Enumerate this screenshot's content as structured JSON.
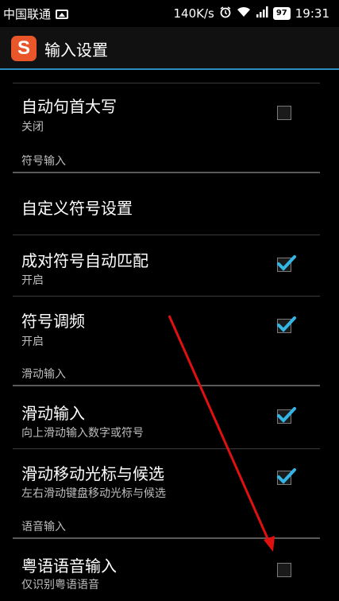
{
  "status_bar": {
    "carrier": "中国联通",
    "speed": "140K/s",
    "battery": "97",
    "time": "19:31"
  },
  "action_bar": {
    "app_icon_letter": "S",
    "title": "输入设置"
  },
  "settings": {
    "auto_cap": {
      "title": "自动句首大写",
      "summary": "关闭",
      "checked": false
    },
    "symbol_section": "符号输入",
    "custom_symbol": {
      "title": "自定义符号设置"
    },
    "pair_match": {
      "title": "成对符号自动匹配",
      "summary": "开启",
      "checked": true
    },
    "symbol_freq": {
      "title": "符号调频",
      "summary": "开启",
      "checked": true
    },
    "swipe_section": "滑动输入",
    "swipe_input": {
      "title": "滑动输入",
      "summary": "向上滑动输入数字或符号",
      "checked": true
    },
    "swipe_cursor": {
      "title": "滑动移动光标与候选",
      "summary": "左右滑动键盘移动光标与候选",
      "checked": true
    },
    "voice_section": "语音输入",
    "cantonese": {
      "title": "粤语语音输入",
      "summary": "仅识别粤语语音",
      "checked": false
    }
  },
  "colors": {
    "accent": "#2b8fc0",
    "check": "#33b5e5",
    "annotation_arrow": "#e01010"
  }
}
